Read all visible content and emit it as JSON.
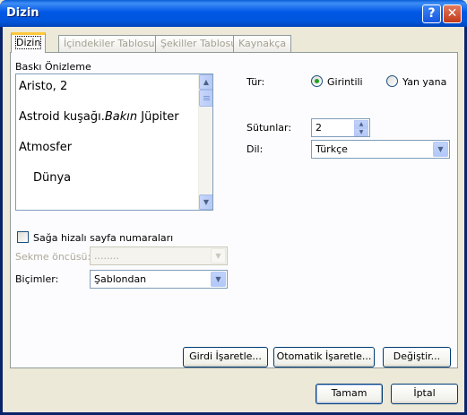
{
  "window": {
    "title": "Dizin",
    "help_icon": "help-icon",
    "close_icon": "close-icon"
  },
  "tabs": [
    {
      "label": "Dizin",
      "active": true
    },
    {
      "label": "İçindekiler Tablosu",
      "active": false
    },
    {
      "label": "Şekiller Tablosu",
      "active": false
    },
    {
      "label": "Kaynakça",
      "active": false
    }
  ],
  "preview": {
    "label": "Baskı Önizleme",
    "lines": [
      "Aristo, 2",
      "Astroid kuşağı.",
      "Bakın",
      " Jüpiter",
      "Atmosfer",
      "Dünya"
    ]
  },
  "type": {
    "label": "Tür:",
    "options": [
      "Girintili",
      "Yan yana"
    ],
    "selected": "Girintili"
  },
  "columns": {
    "label": "Sütunlar:",
    "value": "2"
  },
  "language": {
    "label": "Dil:",
    "value": "Türkçe"
  },
  "right_align": {
    "label": "Sağa hizalı sayfa numaraları",
    "checked": false
  },
  "tab_leader": {
    "label": "Sekme öncüsü:",
    "value": "........",
    "disabled": true
  },
  "formats": {
    "label": "Biçimler:",
    "value": "Şablondan"
  },
  "buttons": {
    "mark_entry": "Girdi İşaretle...",
    "automark": "Otomatik İşaretle...",
    "modify": "Değiştir...",
    "ok": "Tamam",
    "cancel": "İptal"
  }
}
